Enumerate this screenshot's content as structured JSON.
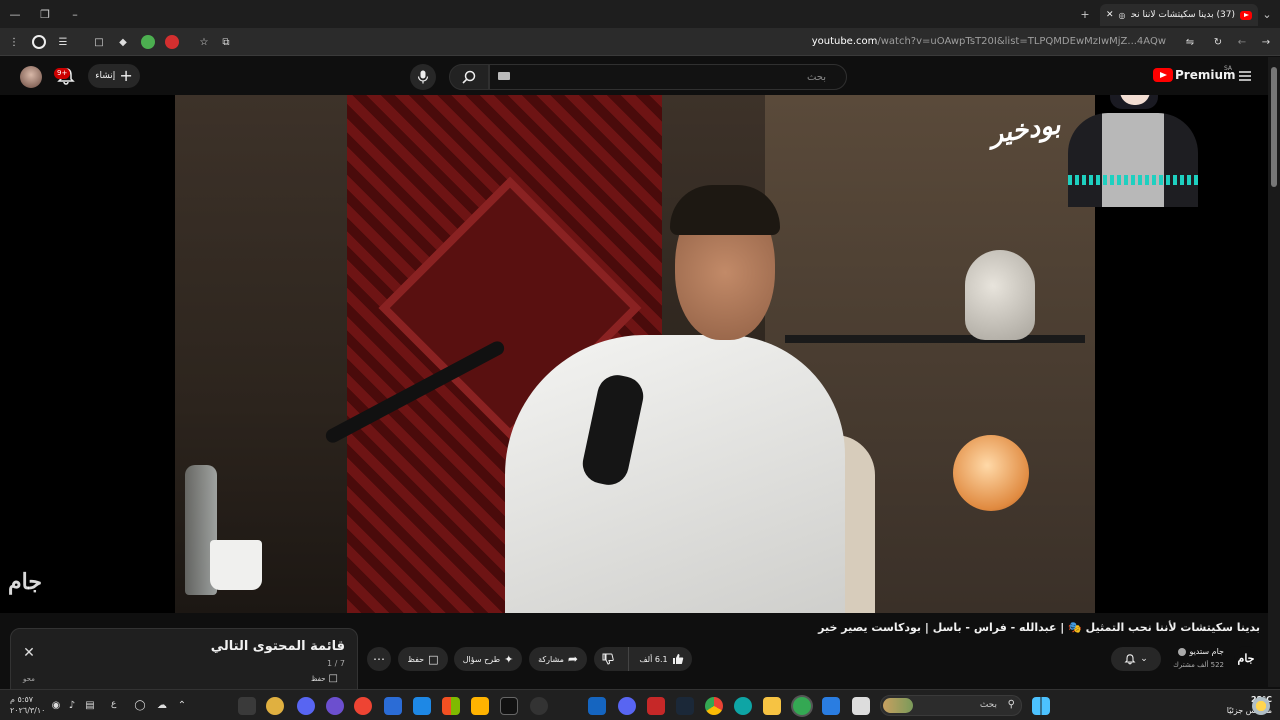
{
  "browser": {
    "tab_title": "(37) بدينا سكيتشات لأننا نحب...",
    "url_host": "youtube.com",
    "url_path": "/watch?v=uOAwpTsT20I&list=TLPQMDEwMzIwMjZ...4AQw"
  },
  "header": {
    "logo_text": "Premium",
    "logo_region": "SA",
    "search_placeholder": "بحث",
    "create_label": "إنشاء",
    "notification_count": "9+"
  },
  "video": {
    "title": "بدينا سكيتشات لأننا نحب التمثيل 🎭 | عبدالله - فراس - باسل | بودكاست يصير خير",
    "channel_name": "جام ستديو",
    "subscribers": "522 ألف مشترك",
    "watermark_left": "جام",
    "watermark_top": "بودخير",
    "like_count": "6.1 ألف",
    "share_label": "مشاركة",
    "ask_label": "طرح سؤال",
    "save_label": "حفظ"
  },
  "playlist": {
    "title": "قائمة المحتوى التالي",
    "count": "1 / 7",
    "save_label": "حفظ",
    "channel": "محو"
  },
  "taskbar": {
    "search_label": "بحث",
    "temperature": "28°C",
    "weather_desc": "مشمس جزئيًا",
    "lang": "ع",
    "time": "٥:٥٧ م",
    "date": "٢٠٢٦/٣/١٠"
  },
  "colors": {
    "accent": "#ff0000",
    "bg": "#0f0f0f",
    "surface": "#272727"
  }
}
